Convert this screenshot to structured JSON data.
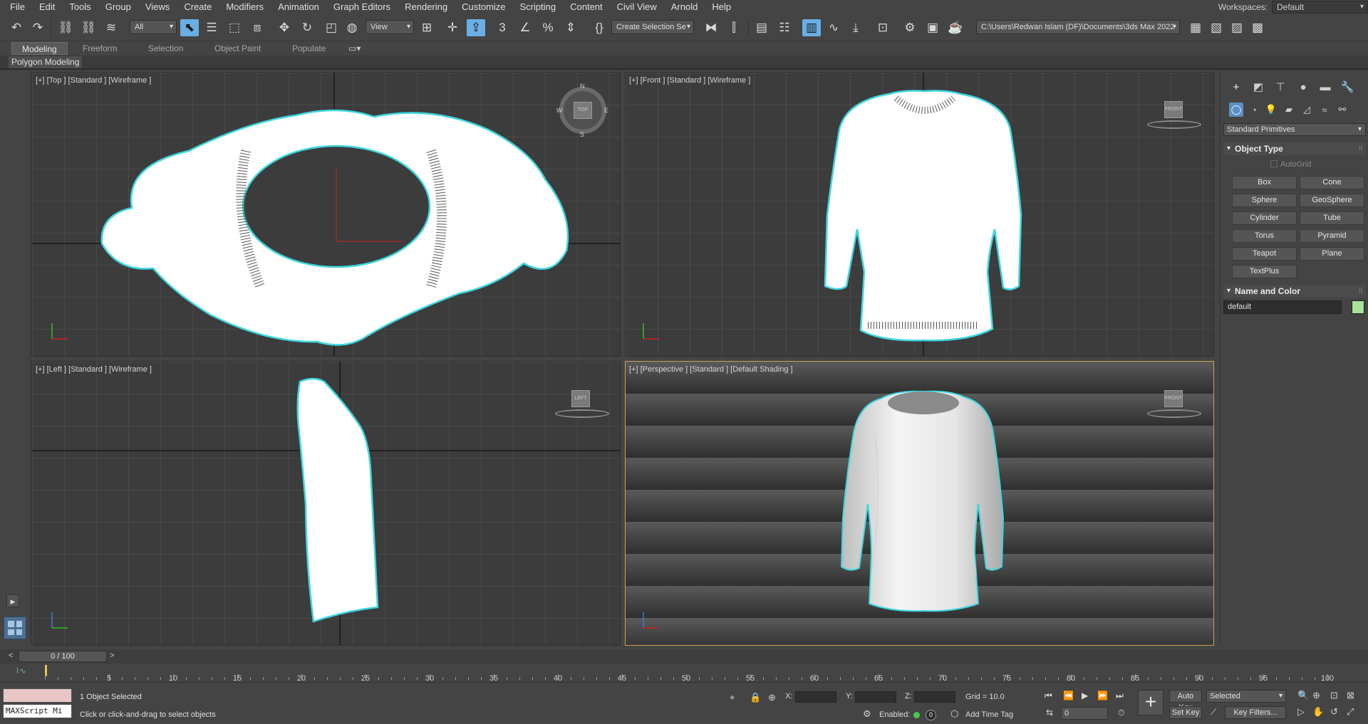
{
  "menu": [
    "File",
    "Edit",
    "Tools",
    "Group",
    "Views",
    "Create",
    "Modifiers",
    "Animation",
    "Graph Editors",
    "Rendering",
    "Customize",
    "Scripting",
    "Content",
    "Civil View",
    "Arnold",
    "Help"
  ],
  "workspace": {
    "label": "Workspaces:",
    "value": "Default"
  },
  "toolbar": {
    "filter_value": "All",
    "view_value": "View",
    "selection_set_value": "Create Selection Se",
    "path_value": "C:\\Users\\Redwan Islam (DF)\\Documents\\3ds Max 2022",
    "icons": [
      "undo-icon",
      "redo-icon",
      "link-icon",
      "unlink-icon",
      "bind-space-warp-icon",
      "select-object-icon",
      "select-by-name-icon",
      "rect-selection-icon",
      "window-crossing-icon",
      "move-icon",
      "rotate-icon",
      "scale-icon",
      "select-place-icon",
      "pivot-center-icon",
      "select-manipulate-icon",
      "snaps-toggle-icon",
      "angle-snap-icon",
      "percent-snap-icon",
      "spinner-snap-icon",
      "named-selection-icon",
      "mirror-icon",
      "align-icon",
      "scene-explorer-icon",
      "layer-explorer-icon",
      "toggle-ribbon-icon",
      "curve-editor-icon",
      "schematic-view-icon",
      "material-editor-icon",
      "render-setup-icon",
      "rendered-frame-icon",
      "render-icon"
    ]
  },
  "ribbon": {
    "tabs": [
      "Modeling",
      "Freeform",
      "Selection",
      "Object Paint",
      "Populate"
    ],
    "active_tab": "Modeling",
    "sub_label": "Polygon Modeling"
  },
  "viewports": {
    "top": {
      "label": "[+] [Top ] [Standard ] [Wireframe ]",
      "cube": "TOP",
      "compass": [
        "N",
        "E",
        "S",
        "W"
      ]
    },
    "front": {
      "label": "[+] [Front ] [Standard ] [Wireframe ]",
      "cube": "FRONT"
    },
    "left": {
      "label": "[+] [Left ] [Standard ] [Wireframe ]",
      "cube": "LEFT"
    },
    "persp": {
      "label": "[+] [Perspective ] [Standard ] [Default Shading ]",
      "cube": "FRONT"
    }
  },
  "command_panel": {
    "tabs": [
      "create-icon",
      "modify-icon",
      "hierarchy-icon",
      "motion-icon",
      "display-icon",
      "utilities-icon"
    ],
    "subtabs": [
      "geometry-icon",
      "shapes-icon",
      "lights-icon",
      "cameras-icon",
      "helpers-icon",
      "space-warps-icon",
      "systems-icon"
    ],
    "category": "Standard Primitives",
    "object_type_title": "Object Type",
    "autogrid_label": "AutoGrid",
    "primitives": [
      "Box",
      "Cone",
      "Sphere",
      "GeoSphere",
      "Cylinder",
      "Tube",
      "Torus",
      "Pyramid",
      "Teapot",
      "Plane",
      "TextPlus"
    ],
    "name_color_title": "Name and Color",
    "object_name": "default",
    "object_color": "#a8e39a"
  },
  "timeline": {
    "slider_text": "0 / 100",
    "ticks": [
      0,
      5,
      10,
      15,
      20,
      25,
      30,
      35,
      40,
      45,
      50,
      55,
      60,
      65,
      70,
      75,
      80,
      85,
      90,
      95,
      100
    ],
    "max_frame": 100
  },
  "status": {
    "maxscript_placeholder": "MAXScript Mi",
    "selection_msg": "1 Object Selected",
    "prompt_msg": "Click or click-and-drag to select objects",
    "x_label": "X:",
    "y_label": "Y:",
    "z_label": "Z:",
    "grid_text": "Grid = 10.0",
    "enabled_label": "Enabled:",
    "time_tag_count": "0",
    "add_time_tag": "Add Time Tag",
    "auto_key": "Auto Key",
    "set_key": "Set Key",
    "selected_value": "Selected",
    "frame_value": "0",
    "key_filters": "Key Filters..."
  },
  "colors": {
    "selection_outline": "#3ed6e0",
    "active_button": "#6aaee6",
    "active_viewport_border": "#c9a24a"
  }
}
